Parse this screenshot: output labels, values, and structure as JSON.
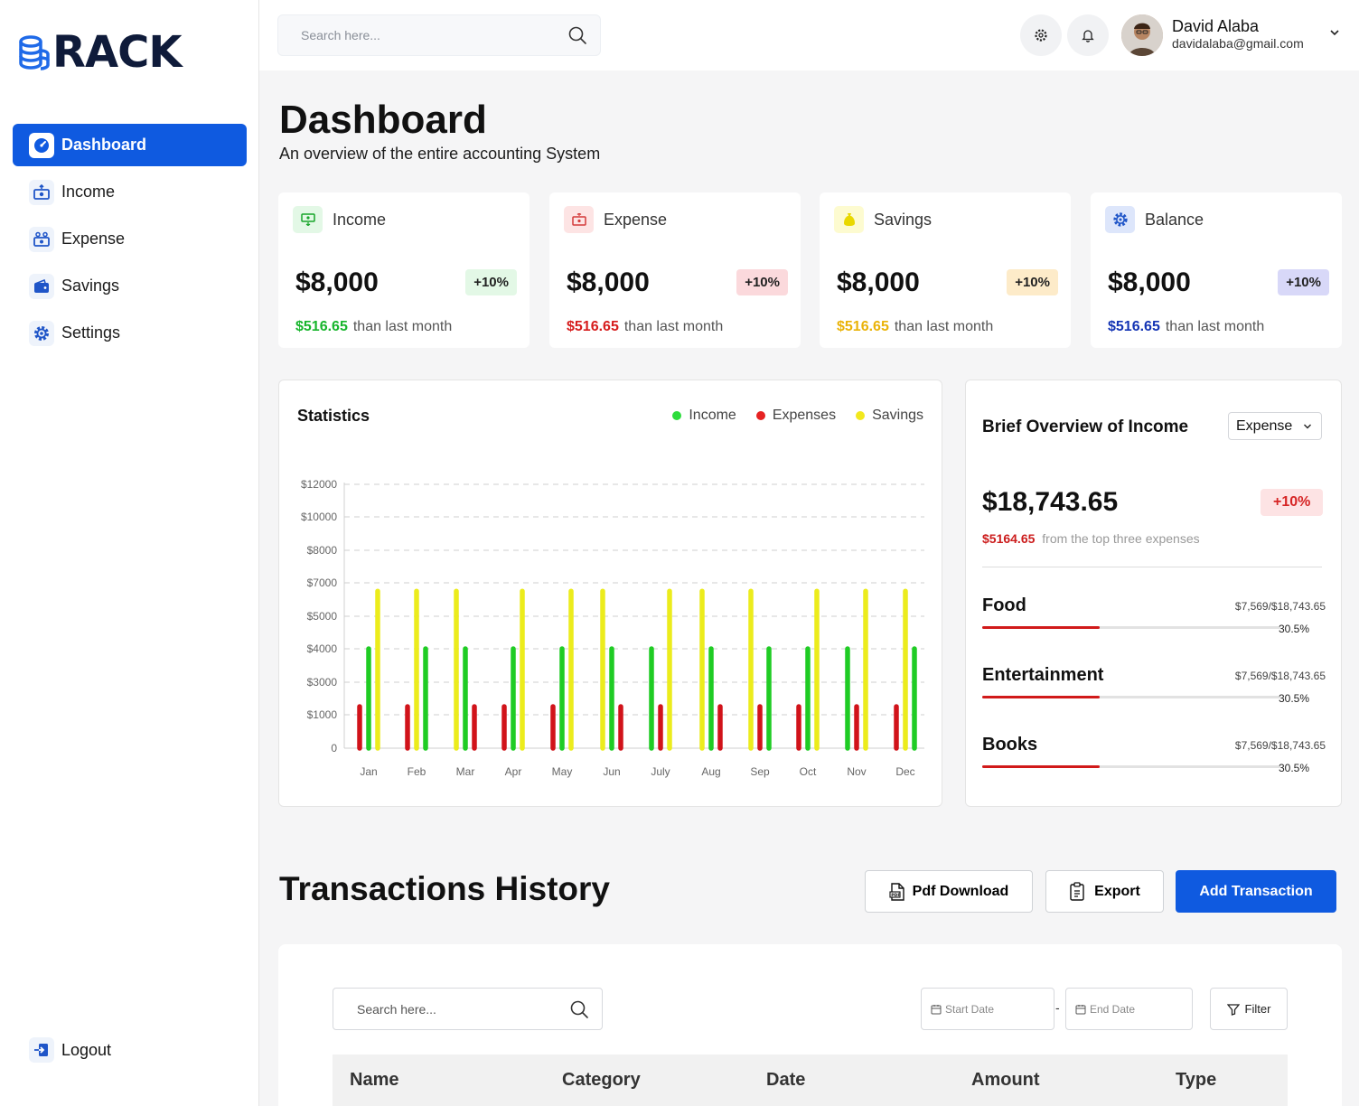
{
  "brand": {
    "name": "RACK"
  },
  "sidebar": {
    "items": [
      {
        "label": "Dashboard",
        "icon": "dashboard-icon",
        "active": true
      },
      {
        "label": "Income",
        "icon": "income-icon"
      },
      {
        "label": "Expense",
        "icon": "expense-icon"
      },
      {
        "label": "Savings",
        "icon": "wallet-icon"
      },
      {
        "label": "Settings",
        "icon": "gear-icon"
      }
    ],
    "logout": "Logout"
  },
  "header": {
    "search_placeholder": "Search here...",
    "user": {
      "name": "David Alaba",
      "email": "davidalaba@gmail.com"
    }
  },
  "page": {
    "title": "Dashboard",
    "subtitle": "An overview of the entire accounting System"
  },
  "cards": [
    {
      "title": "Income",
      "value": "$8,000",
      "badge": "+10%",
      "delta": "$516.65",
      "foot": "than last month",
      "color": "#17b52c",
      "badge_bg": "#e3f8e6",
      "icon_bg": "#e3f8e6"
    },
    {
      "title": "Expense",
      "value": "$8,000",
      "badge": "+10%",
      "delta": "$516.65",
      "foot": "than last month",
      "color": "#d61c1c",
      "badge_bg": "#fbd9dc",
      "icon_bg": "#fde4e4"
    },
    {
      "title": "Savings",
      "value": "$8,000",
      "badge": "+10%",
      "delta": "$516.65",
      "foot": "than last month",
      "color": "#eab308",
      "badge_bg": "#fdebc9",
      "icon_bg": "#fdfbd0"
    },
    {
      "title": "Balance",
      "value": "$8,000",
      "badge": "+10%",
      "delta": "$516.65",
      "foot": "than last month",
      "color": "#1434b4",
      "badge_bg": "#d8d8f8",
      "icon_bg": "#dde6fb"
    }
  ],
  "statistics": {
    "title": "Statistics",
    "legend": [
      {
        "name": "Income",
        "color": "#2ddc3c"
      },
      {
        "name": "Expenses",
        "color": "#e62222"
      },
      {
        "name": "Savings",
        "color": "#f2e81d"
      }
    ]
  },
  "chart_data": {
    "type": "bar",
    "title": "Statistics",
    "categories": [
      "Jan",
      "Feb",
      "Mar",
      "Apr",
      "May",
      "Jun",
      "July",
      "Aug",
      "Sep",
      "Oct",
      "Nov",
      "Dec"
    ],
    "y_ticks": [
      "0",
      "$1000",
      "$3000",
      "$4000",
      "$5000",
      "$7000",
      "$8000",
      "$10000",
      "$12000"
    ],
    "grid": "dashed horizontal",
    "legend_position": "top-right",
    "series": [
      {
        "name": "Income",
        "color": "#1fcc24",
        "values": [
          4000,
          4000,
          4000,
          4000,
          4000,
          4000,
          4000,
          4000,
          4000,
          4000,
          4000,
          4000
        ]
      },
      {
        "name": "Expenses",
        "color": "#d1131a",
        "values": [
          1500,
          1500,
          1500,
          1500,
          1500,
          1500,
          1500,
          1500,
          1500,
          1500,
          1500,
          1500
        ]
      },
      {
        "name": "Savings",
        "color": "#ecec1c",
        "values": [
          6500,
          6500,
          6500,
          6500,
          6500,
          6500,
          6500,
          6500,
          6500,
          6500,
          6500,
          6500
        ]
      }
    ],
    "order": [
      [
        "Expenses",
        "Income",
        "Savings"
      ],
      [
        "Expenses",
        "Savings",
        "Income"
      ],
      [
        "Savings",
        "Income",
        "Expenses"
      ],
      [
        "Expenses",
        "Income",
        "Savings"
      ],
      [
        "Expenses",
        "Income",
        "Savings"
      ],
      [
        "Savings",
        "Income",
        "Expenses"
      ],
      [
        "Income",
        "Expenses",
        "Savings"
      ],
      [
        "Savings",
        "Income",
        "Expenses"
      ],
      [
        "Savings",
        "Expenses",
        "Income"
      ],
      [
        "Expenses",
        "Income",
        "Savings"
      ],
      [
        "Income",
        "Expenses",
        "Savings"
      ],
      [
        "Expenses",
        "Savings",
        "Income"
      ]
    ]
  },
  "brief": {
    "title": "Brief Overview of Income",
    "select_value": "Expense",
    "total": "$18,743.65",
    "badge": "+10%",
    "foot_value": "$5164.65",
    "foot_text": "from the top three expenses",
    "categories": [
      {
        "name": "Food",
        "ratio": "$7,569/$18,743.65",
        "percent": "30.5%",
        "fraction": 0.395
      },
      {
        "name": "Entertainment",
        "ratio": "$7,569/$18,743.65",
        "percent": "30.5%",
        "fraction": 0.395
      },
      {
        "name": "Books",
        "ratio": "$7,569/$18,743.65",
        "percent": "30.5%",
        "fraction": 0.395
      }
    ]
  },
  "transactions": {
    "title": "Transactions History",
    "pdf_label": "Pdf Download",
    "export_label": "Export",
    "add_label": "Add Transaction",
    "search_placeholder": "Search here...",
    "start_date": "Start Date",
    "end_date": "End Date",
    "date_sep": "-",
    "filter_label": "Filter",
    "columns": [
      "Name",
      "Category",
      "Date",
      "Amount",
      "Type"
    ]
  }
}
